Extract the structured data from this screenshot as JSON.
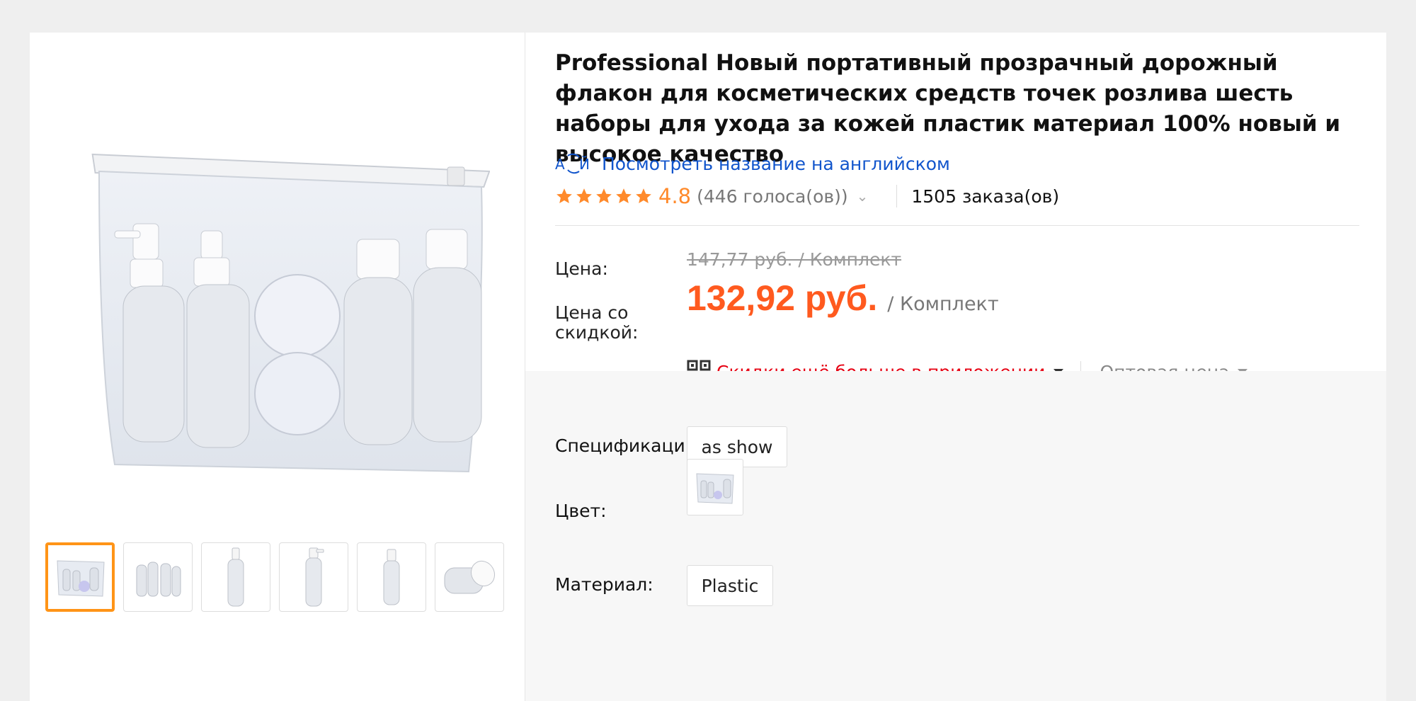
{
  "product": {
    "title": "Professional Новый портативный прозрачный дорожный флакон для косметических средств точек розлива шесть наборы для ухода за кожей пластик материал 100% новый и высокое качество",
    "translate_link": "Посмотреть название на английском",
    "translate_icon": "translate-icon",
    "rating": {
      "stars": 5,
      "value": "4.8",
      "votes": "(446 голоса(ов))",
      "orders": "1505 заказа(ов)"
    }
  },
  "price": {
    "price_label": "Цена:",
    "old_price": "147,77 руб. / Комплект",
    "discount_label": "Цена со скидкой:",
    "new_price": "132,92 руб.",
    "unit": "/ Комплект",
    "app_promo": "Скидки ещё больше в приложении",
    "wholesale": "Оптовая цена"
  },
  "options": {
    "spec_label": "Спецификации:",
    "spec_value": "as show",
    "color_label": "Цвет:",
    "material_label": "Материал:",
    "material_value": "Plastic"
  },
  "gallery": {
    "thumbnail_count": 6,
    "active_index": 0
  },
  "colors": {
    "accent_orange": "#ff9417",
    "price_orange": "#ff5a1f",
    "link_blue": "#1155cc",
    "promo_red": "#e60012",
    "star_orange": "#ff8a2b"
  }
}
